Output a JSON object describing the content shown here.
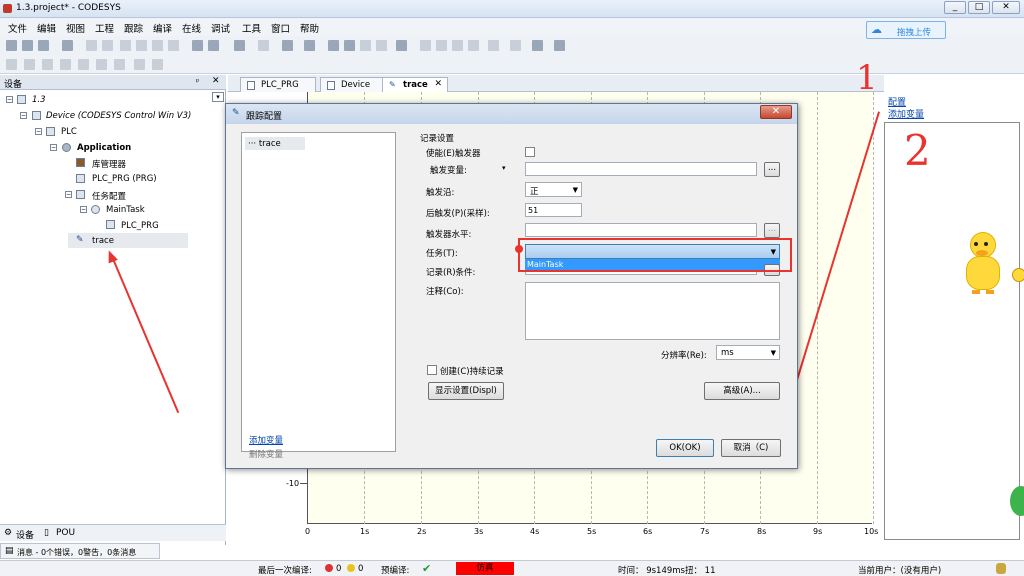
{
  "window": {
    "title": "1.3.project* - CODESYS",
    "min": "□",
    "max": "□",
    "close": "✕"
  },
  "menu": [
    "文件",
    "编辑",
    "视图",
    "工程",
    "跟踪",
    "编译",
    "在线",
    "调试",
    "工具",
    "窗口",
    "帮助"
  ],
  "upload_label": "拖拽上传",
  "device_panel": {
    "title": "设备",
    "pin": "▾ ✕",
    "tree": [
      {
        "label": "1.3",
        "indent": 0,
        "italic": true
      },
      {
        "label": "Device (CODESYS Control Win V3)",
        "indent": 1,
        "italic": true
      },
      {
        "label": "PLC",
        "indent": 2
      },
      {
        "label": "Application",
        "indent": 3,
        "bold": true
      },
      {
        "label": "库管理器",
        "indent": 4
      },
      {
        "label": "PLC_PRG (PRG)",
        "indent": 4
      },
      {
        "label": "任务配置",
        "indent": 4
      },
      {
        "label": "MainTask",
        "indent": 5
      },
      {
        "label": "PLC_PRG",
        "indent": 6
      },
      {
        "label": "trace",
        "indent": 4
      }
    ],
    "bottom_tabs": [
      "设备",
      "POU"
    ],
    "messages": "消息 - 0个错误，0警告，0条消息"
  },
  "doc_tabs": [
    {
      "label": "PLC_PRG"
    },
    {
      "label": "Device"
    },
    {
      "label": "trace",
      "active": true
    }
  ],
  "plot": {
    "x_ticks": [
      "0",
      "1s",
      "2s",
      "3s",
      "4s",
      "5s",
      "6s",
      "7s",
      "8s",
      "9s",
      "10s"
    ],
    "y_tick": "-10"
  },
  "right_panel": {
    "config": "配置",
    "add_var": "添加变量"
  },
  "dialog": {
    "title": "跟踪配置",
    "tree_item": "trace",
    "section": "记录设置",
    "enable_trigger": "使能(E)触发器",
    "trigger_var": "触发变量:",
    "trigger_edge": "触发沿:",
    "trigger_edge_value": "正",
    "post_trigger": "后触发(P)(采样):",
    "post_trigger_value": "51",
    "trigger_level": "触发器水平:",
    "task": "任务(T):",
    "task_option": "MainTask",
    "record_cond": "记录(R)条件:",
    "comment": "注释(Co):",
    "resolution": "分辨率(Re):",
    "resolution_value": "ms",
    "persistent": "创建(C)持续记录",
    "display_settings": "显示设置(Displ)",
    "advanced": "高级(A)...",
    "add_var": "添加变量",
    "del_var": "删除变量",
    "ok": "OK(OK)",
    "cancel": "取消（C)",
    "ellipsis": "..."
  },
  "annotations": {
    "one": "1",
    "two": "2"
  },
  "status": {
    "last_compile": "最后一次编译:",
    "errors": "0",
    "warnings": "0",
    "precompile": "预编译:",
    "sim": "仿真",
    "time": "时间：  9s149ms扭：  11",
    "user": "当前用户：(没有用户)"
  },
  "colors": {
    "annotation_red": "#e8332e",
    "sim_red": "#ff0000",
    "accent": "#3399ff"
  }
}
